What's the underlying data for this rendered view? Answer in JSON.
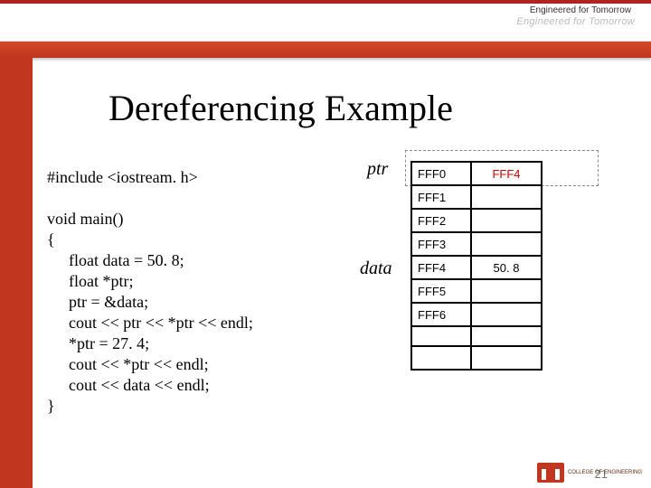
{
  "chrome": {
    "tagline_top": "Engineered for Tomorrow",
    "tagline_faded": "Engineered for Tomorrow",
    "footer_text": "COLLEGE OF\nENGINEERING",
    "page_number": "21"
  },
  "title": "Dereferencing Example",
  "code": {
    "l0": "#include <iostream. h>",
    "l1": "",
    "l2": "void main()",
    "l3": "{",
    "l4": "float data = 50. 8;",
    "l5": "float *ptr;",
    "l6": "ptr = &data;",
    "l7": "cout << ptr << *ptr << endl;",
    "l8": "*ptr = 27. 4;",
    "l9": "cout << *ptr << endl;",
    "l10": "cout << data << endl;",
    "l11": "}"
  },
  "labels": {
    "ptr": "ptr",
    "data": "data"
  },
  "memory": {
    "rows": [
      {
        "addr": "FFF0",
        "val": "FFF4",
        "val_class": "red"
      },
      {
        "addr": "FFF1",
        "val": ""
      },
      {
        "addr": "FFF2",
        "val": ""
      },
      {
        "addr": "FFF3",
        "val": ""
      },
      {
        "addr": "FFF4",
        "val": "50. 8"
      },
      {
        "addr": "FFF5",
        "val": ""
      },
      {
        "addr": "FFF6",
        "val": ""
      }
    ]
  }
}
